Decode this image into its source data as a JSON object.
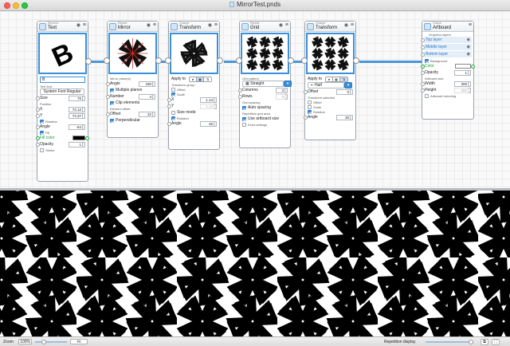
{
  "window": {
    "title": "MirrorTest.pnds"
  },
  "nodes": {
    "text": {
      "category": "Element",
      "name": "Text",
      "field_value": "B",
      "font_label": "Text font",
      "font_value": "System Font Regular",
      "size_label": "Size",
      "size_value": "75",
      "position_label": "Position",
      "x_label": "X",
      "x_value": "74.12",
      "y_label": "Y",
      "y_value": "74.37",
      "rotation_label": "Rotation",
      "angle_label": "Angle",
      "angle_value": "-64",
      "fill_label": "Fill",
      "fillcolor_label": "Fill color",
      "opacity_label": "Opacity",
      "opacity_value": "1",
      "stroke_label": "Stroke",
      "preview_glyph": "B"
    },
    "mirror": {
      "category": "Repeat",
      "name": "Mirror",
      "planes_label": "Mirror plane(s)",
      "angle_label": "Angle",
      "angle_value": "180",
      "multiple_label": "Multiple planes",
      "number_label": "Number",
      "number_value": "4",
      "clip_label": "Clip elements",
      "element_offset_label": "Element offset",
      "offset_label": "Offset",
      "offset_value": "22",
      "perpendicular_label": "Perpendicular"
    },
    "transform": {
      "category": "Change",
      "name": "Transform",
      "apply_label": "Apply to",
      "group_label": "Transform group",
      "offset_label": "Offset",
      "scale_label": "Scale",
      "x_label": "X",
      "x_value": "1.14",
      "y_label": "Y",
      "y_value": "1.14",
      "sizemode_label": "Size mode",
      "rotation_label": "Rotation",
      "angle_label": "Angle",
      "angle_value": "45"
    },
    "grid": {
      "category": "Repeat",
      "name": "Grid",
      "pattern_label": "Grid pattern",
      "pattern_value": "Straight",
      "columns_label": "Columns",
      "columns_value": "3",
      "rows_label": "Rows",
      "rows_value": "3",
      "spacing_label": "Grid spacing",
      "auto_label": "Auto spacing",
      "area_label": "Repetition grid area",
      "artboard_label": "Use artboard size",
      "extra_label": "Extra settings"
    },
    "transform2": {
      "category": "Change",
      "name": "Transform",
      "apply_label": "Apply to",
      "half_value": "Half",
      "offset_label": "Offset",
      "offset_value": "0",
      "selected_label": "Transform selected",
      "offset_cb": "Offset",
      "scale_cb": "Scale",
      "rotation_cb": "Rotation",
      "angle_label": "Angle",
      "angle_value": "45"
    },
    "artboard": {
      "category": "Output",
      "name": "Artboard",
      "layers_label": "Graphics layers",
      "layers": [
        "Top layer",
        "Middle layer",
        "Bottom layer"
      ],
      "background_label": "Background",
      "color_label": "Color",
      "opacity_label": "Opacity",
      "opacity_value": "1",
      "size_label": "Artboard size",
      "width_label": "Width",
      "width_value": "300",
      "height_label": "Height",
      "height_value": "300",
      "mirroring_label": "Artboard mirroring"
    }
  },
  "bottombar": {
    "zoom_label": "Zoom",
    "zoom_value": "100%",
    "fit_label": "Fit",
    "repetition_label": "Repetition display"
  },
  "colors": {
    "accent": "#3a8fda",
    "wire": "#4a96d8",
    "fill_color_swatch": "#000000",
    "green": "#1c9a3a"
  },
  "icons": [
    "eye-icon",
    "menu-icon",
    "node-icon",
    "stepper-icon"
  ]
}
